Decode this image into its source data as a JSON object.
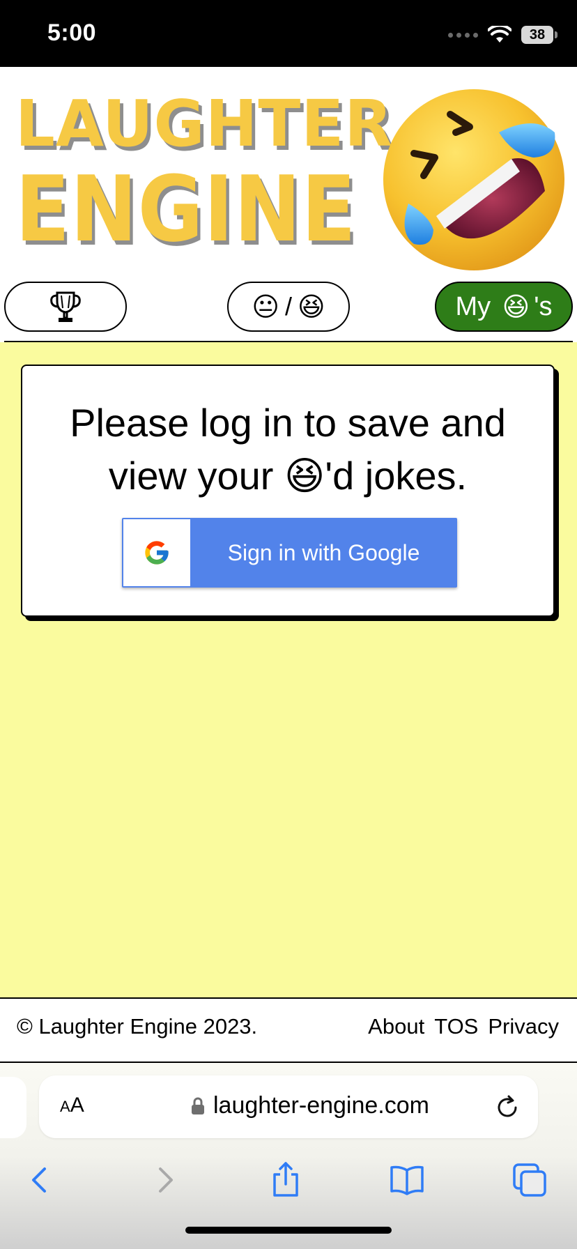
{
  "status_bar": {
    "time": "5:00",
    "battery": "38",
    "icons": [
      "signal-icon",
      "wifi-icon",
      "battery-icon"
    ]
  },
  "header": {
    "logo_line1": "LAUGHTER",
    "logo_line2": "ENGINE",
    "logo_emoji": "rolling-on-floor-laughing-emoji",
    "logo_color": "#f6c944"
  },
  "nav": {
    "leaderboard_icon": "trophy-icon",
    "rate_neutral": "😐",
    "rate_separator": "/",
    "rate_laugh": "😆",
    "my_prefix": "My ",
    "my_emoji": "😆",
    "my_suffix": "'s",
    "active_color": "#2e7d18"
  },
  "main": {
    "background": "#fafb9e",
    "message_line1": "Please log in to save and",
    "message_line2_prefix": "view your ",
    "message_emoji": "😆",
    "message_line2_suffix": "'d jokes.",
    "google_button_label": "Sign in with Google",
    "google_button_color": "#5283ea"
  },
  "footer": {
    "copyright": "© Laughter Engine 2023.",
    "links": [
      "About",
      "TOS",
      "Privacy"
    ]
  },
  "browser": {
    "text_size_button": "AA",
    "url": "laughter-engine.com",
    "toolbar_icons": [
      "back-icon",
      "forward-icon",
      "share-icon",
      "bookmarks-icon",
      "tabs-icon"
    ],
    "accent_color": "#2f7cf6"
  }
}
